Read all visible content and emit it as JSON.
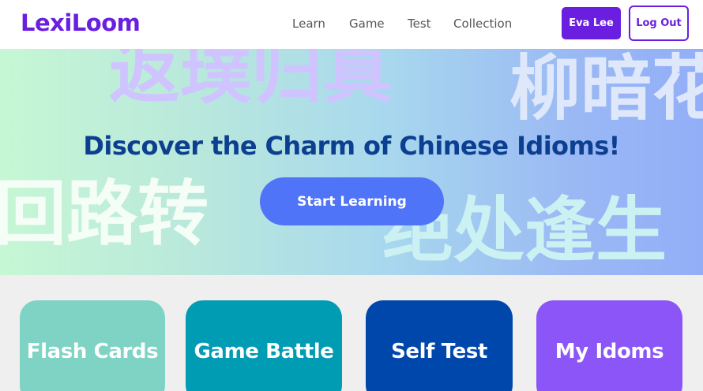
{
  "header": {
    "logo": "LexiLoom",
    "nav": [
      "Learn",
      "Game",
      "Test",
      "Collection"
    ],
    "user_label": "Eva Lee",
    "logout_label": "Log Out"
  },
  "hero": {
    "background_words": [
      "返璞归真",
      "柳暗花",
      "回路转",
      "绝处逢生"
    ],
    "title": "Discover the Charm of Chinese Idioms!",
    "cta_label": "Start Learning"
  },
  "features": [
    {
      "label": "Flash Cards",
      "color": "#7ed3c4"
    },
    {
      "label": "Game Battle",
      "color": "#009cb3"
    },
    {
      "label": "Self Test",
      "color": "#0047ac"
    },
    {
      "label": "My Idoms",
      "color": "#8c55f7"
    }
  ],
  "colors": {
    "brand": "#6a1fe0",
    "cta": "#4f74f7",
    "hero_title": "#0d3f91"
  }
}
